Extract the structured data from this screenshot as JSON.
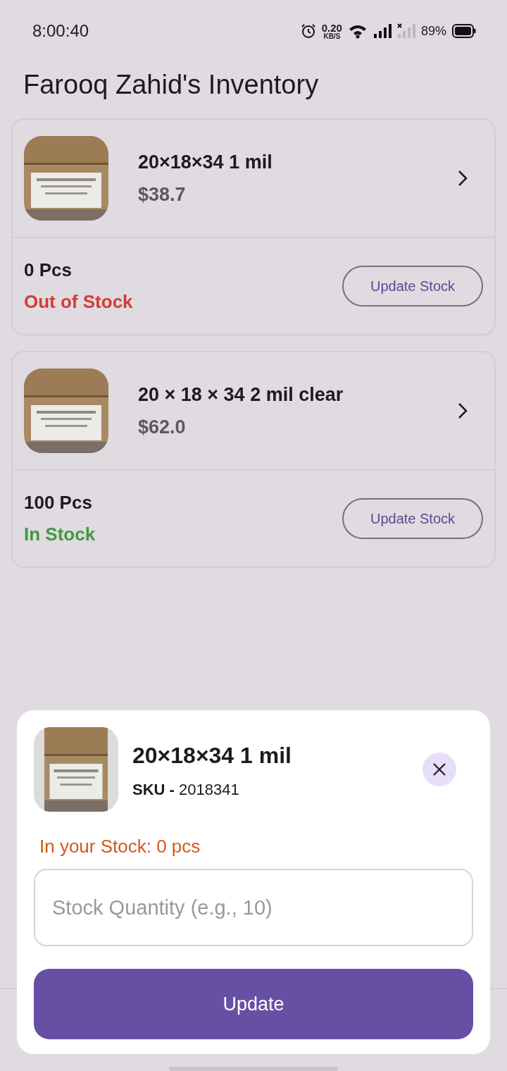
{
  "status_bar": {
    "time": "8:00:40",
    "speed": "0.20",
    "speed_unit": "KB/S",
    "battery": "89%"
  },
  "title": "Farooq Zahid's Inventory",
  "products": [
    {
      "name": "20×18×34 1 mil",
      "price": "$38.7",
      "quantity": "0 Pcs",
      "in_stock": false,
      "stock_label": "Out of Stock",
      "button": "Update Stock"
    },
    {
      "name": "20 × 18 × 34 2 mil clear",
      "price": "$62.0",
      "quantity": "100 Pcs",
      "in_stock": true,
      "stock_label": "In Stock",
      "button": "Update Stock"
    }
  ],
  "sheet": {
    "name": "20×18×34 1 mil",
    "sku_label": "SKU -",
    "sku": "2018341",
    "stock_note": "In your Stock: 0 pcs",
    "quantity_field": {
      "placeholder": "Stock Quantity (e.g., 10)"
    },
    "button": "Update"
  }
}
